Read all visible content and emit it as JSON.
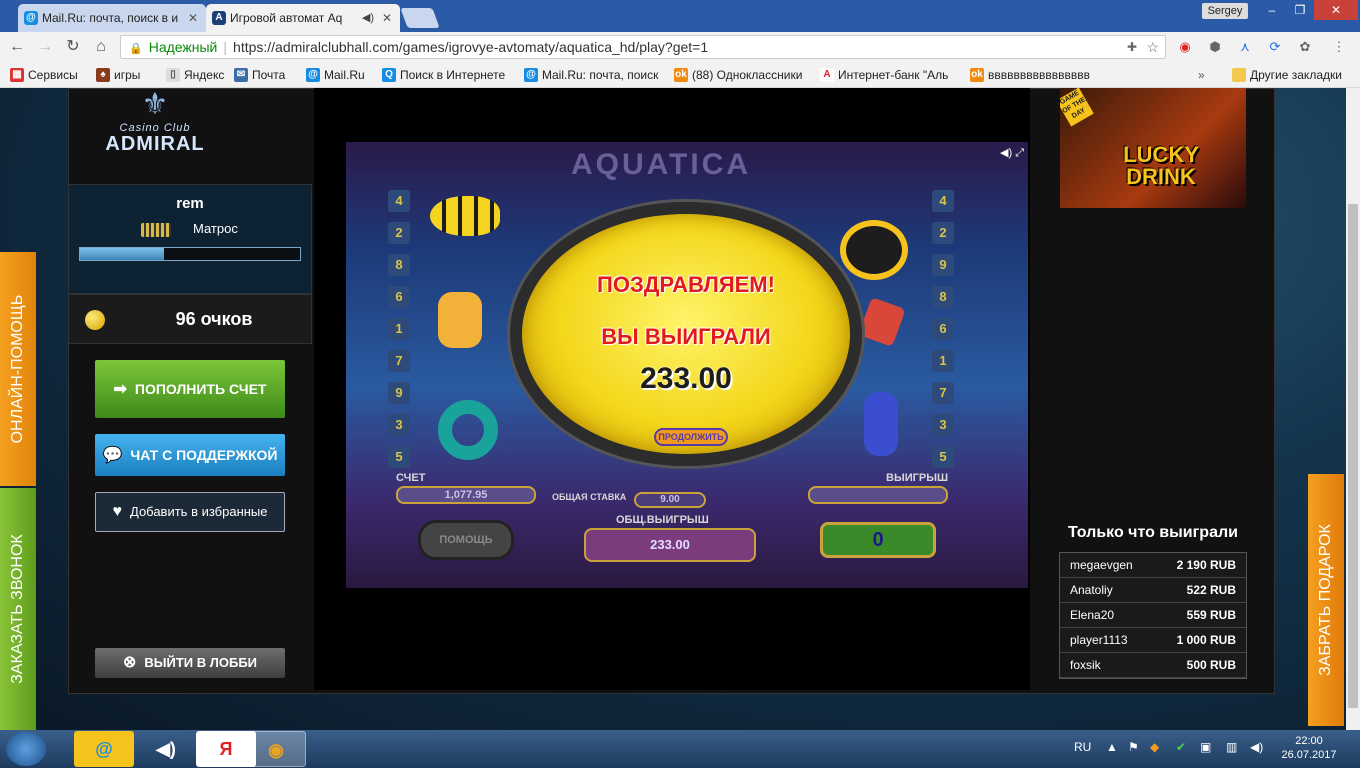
{
  "browser": {
    "tabs": [
      {
        "title": "Mail.Ru: почта, поиск в и",
        "active": false
      },
      {
        "title": "Игровой автомат Aq",
        "active": true
      }
    ],
    "user": "Sergey",
    "secure_label": "Надежный",
    "url": "https://admiralclubhall.com/games/igrovye-avtomaty/aquatica_hd/play?get=1",
    "bookmarks": [
      "Сервисы",
      "игры",
      "Яндекс",
      "Почта",
      "Mail.Ru",
      "Поиск в Интернете",
      "Mail.Ru: почта, поиск",
      "(88) Одноклассники",
      "Интернет-банк \"Аль",
      "вввввввввввввввв"
    ],
    "other_bookmarks": "Другие закладки"
  },
  "sidebar": {
    "logo": {
      "casino": "Casino Club",
      "name": "ADMIRAL"
    },
    "username": "rem",
    "rank": "Матрос",
    "progress_fraction": 0.38,
    "points": "96 очков",
    "deposit_label": "ПОПОЛНИТЬ СЧЕТ",
    "chat_label": "ЧАТ С ПОДДЕРЖКОЙ",
    "favorite_label": "Добавить в избранные",
    "lobby_label": "ВЫЙТИ В ЛОББИ"
  },
  "game": {
    "title": "AQUATICA",
    "reel_numbers_left": [
      "4",
      "2",
      "8",
      "6",
      "1",
      "7",
      "9",
      "3",
      "5"
    ],
    "reel_numbers_right": [
      "4",
      "2",
      "9",
      "8",
      "6",
      "1",
      "7",
      "3",
      "5"
    ],
    "congrats": "ПОЗДРАВЛЯЕМ!",
    "you_won": "ВЫ ВЫИГРАЛИ",
    "win_amount": "233.00",
    "continue_label": "ПРОДОЛЖИТЬ",
    "credit_label": "СЧЕТ",
    "credit_value": "1,077.95",
    "bet_label": "ОБЩАЯ СТАВКА",
    "bet_value": "9.00",
    "total_win_label": "ОБЩ.ВЫИГРЫШ",
    "total_win_value": "233.00",
    "win_label": "ВЫИГРЫШ",
    "win_counter": "0",
    "help_label": "ПОМОЩЬ"
  },
  "promo": {
    "badge": "GAME OF THE DAY",
    "title": "LUCKY DRINK"
  },
  "winners": {
    "title": "Только что выиграли",
    "rows": [
      {
        "name": "megaevgen",
        "amount": "2 190 RUB"
      },
      {
        "name": "Anatoliy",
        "amount": "522 RUB"
      },
      {
        "name": "Elena20",
        "amount": "559 RUB"
      },
      {
        "name": "player1113",
        "amount": "1 000 RUB"
      },
      {
        "name": "foxsik",
        "amount": "500 RUB"
      }
    ]
  },
  "side_tabs": {
    "help": "ОНЛАЙН-ПОМОЩЬ",
    "call": "ЗАКАЗАТЬ ЗВОНОК",
    "gift": "ЗАБРАТЬ ПОДАРОК"
  },
  "taskbar": {
    "lang": "RU",
    "time": "22:00",
    "date": "26.07.2017"
  },
  "colors": {
    "deposit": "#5aa82a",
    "chat": "#2a96d6",
    "accent_gold": "#d6a300",
    "win_red": "#e11b1b"
  }
}
